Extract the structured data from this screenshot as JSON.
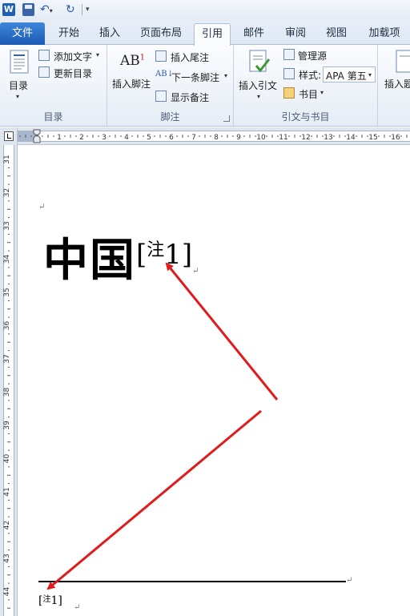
{
  "qat": {
    "app_logo": "W",
    "icons": [
      "save-icon",
      "undo-icon",
      "redo-icon",
      "customize-icon"
    ]
  },
  "tabs": [
    {
      "label": "文件",
      "active": false
    },
    {
      "label": "开始",
      "active": false
    },
    {
      "label": "插入",
      "active": false
    },
    {
      "label": "页面布局",
      "active": false
    },
    {
      "label": "引用",
      "active": true
    },
    {
      "label": "邮件",
      "active": false
    },
    {
      "label": "审阅",
      "active": false
    },
    {
      "label": "视图",
      "active": false
    },
    {
      "label": "加载项",
      "active": false
    }
  ],
  "ribbon": {
    "toc_group": {
      "label": "目录",
      "toc_button": "目录",
      "add_text": "添加文字",
      "update_toc": "更新目录"
    },
    "footnote_group": {
      "label": "脚注",
      "insert_footnote": "插入脚注",
      "insert_footnote_icon_text": "AB",
      "insert_footnote_icon_sup": "1",
      "insert_endnote": "插入尾注",
      "next_footnote": "下一条脚注",
      "show_notes": "显示备注"
    },
    "citation_group": {
      "label": "引文与书目",
      "insert_citation": "插入引文",
      "manage_sources": "管理源",
      "style_label": "样式:",
      "style_value": "APA 第五",
      "bibliography": "书目"
    },
    "next_group": {
      "insert_label": "插入题"
    }
  },
  "ruler": {
    "h_labels": [
      "2",
      "1",
      "1",
      "2",
      "3",
      "4",
      "5",
      "6",
      "7",
      "8",
      "9",
      "10",
      "11",
      "12",
      "13",
      "14",
      "15",
      "16"
    ],
    "v_labels": [
      "31",
      "32",
      "33",
      "34",
      "35",
      "36",
      "37",
      "38",
      "39",
      "40",
      "41",
      "42",
      "43",
      "44"
    ]
  },
  "document": {
    "heading": "中国",
    "note_ref_open": "[",
    "note_ref_label": "注",
    "note_ref_num": "1]",
    "footnote_open": "[",
    "footnote_label": "注",
    "footnote_num": "1]",
    "para_mark": "↵"
  },
  "colors": {
    "accent": "#1b5ab6",
    "arrow": "#e01b1b",
    "ribbon_bg": "#f3f6fb"
  }
}
